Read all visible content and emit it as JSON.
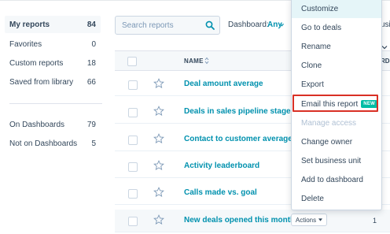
{
  "sidebar": {
    "items": [
      {
        "label": "My reports",
        "count": "84"
      },
      {
        "label": "Favorites",
        "count": "0"
      },
      {
        "label": "Custom reports",
        "count": "18"
      },
      {
        "label": "Saved from library",
        "count": "66"
      },
      {
        "label": "On Dashboards",
        "count": "79"
      },
      {
        "label": "Not on Dashboards",
        "count": "5"
      }
    ]
  },
  "toolbar": {
    "search_placeholder": "Search reports",
    "dashboard_label": "Dashboard:",
    "dashboard_value": "Any",
    "edge_text": "usi"
  },
  "table": {
    "header_name": "NAME",
    "header_right": "RDS",
    "rows": [
      {
        "name": "Deal amount average"
      },
      {
        "name": "Deals in sales pipeline stages by re"
      },
      {
        "name": "Contact to customer average days"
      },
      {
        "name": "Activity leaderboard"
      },
      {
        "name": "Calls made vs. goal"
      },
      {
        "name": "New deals opened this month",
        "actions_label": "Actions",
        "count": "1"
      }
    ]
  },
  "menu": {
    "items": [
      {
        "label": "Customize"
      },
      {
        "label": "Go to deals"
      },
      {
        "label": "Rename"
      },
      {
        "label": "Clone"
      },
      {
        "label": "Export"
      },
      {
        "label": "Email this report",
        "badge": "NEW"
      },
      {
        "label": "Manage access"
      },
      {
        "label": "Change owner"
      },
      {
        "label": "Set business unit"
      },
      {
        "label": "Add to dashboard"
      },
      {
        "label": "Delete"
      }
    ]
  },
  "colors": {
    "link": "#0091ae",
    "text": "#33475b",
    "badge": "#00bda5",
    "highlight": "#d93025"
  }
}
